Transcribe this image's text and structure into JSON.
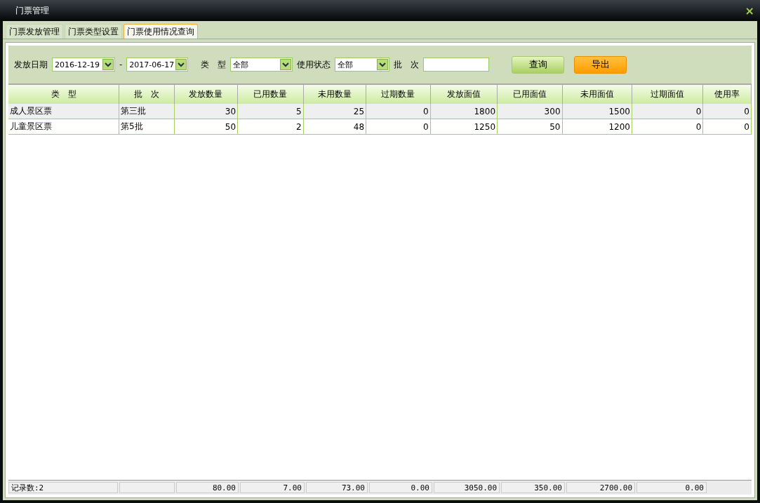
{
  "window": {
    "title": "门票管理",
    "close": "×"
  },
  "tabs": [
    {
      "label": "门票发放管理",
      "selected": false
    },
    {
      "label": "门票类型设置",
      "selected": false
    },
    {
      "label": "门票使用情况查询",
      "selected": true
    }
  ],
  "filters": {
    "date_label": "发放日期",
    "date_from": "2016-12-19",
    "date_sep": "-",
    "date_to": "2017-06-17",
    "type_label": "类　型",
    "type_value": "全部",
    "status_label": "使用状态",
    "status_value": "全部",
    "batch_label": "批　次",
    "query_button": "查询",
    "export_button": "导出"
  },
  "table": {
    "columns": [
      "类　型",
      "批　次",
      "发放数量",
      "已用数量",
      "未用数量",
      "过期数量",
      "发放面值",
      "已用面值",
      "未用面值",
      "过期面值",
      "使用率"
    ],
    "rows": [
      [
        "成人景区票",
        "第三批",
        "30",
        "5",
        "25",
        "0",
        "1800",
        "300",
        "1500",
        "0",
        "0"
      ],
      [
        "儿童景区票",
        "第5批",
        "50",
        "2",
        "48",
        "0",
        "1250",
        "50",
        "1200",
        "0",
        "0"
      ]
    ]
  },
  "footer": {
    "record_count": "记录数:2",
    "totals": [
      "80.00",
      "7.00",
      "73.00",
      "0.00",
      "3050.00",
      "350.00",
      "2700.00",
      "0.00"
    ]
  }
}
